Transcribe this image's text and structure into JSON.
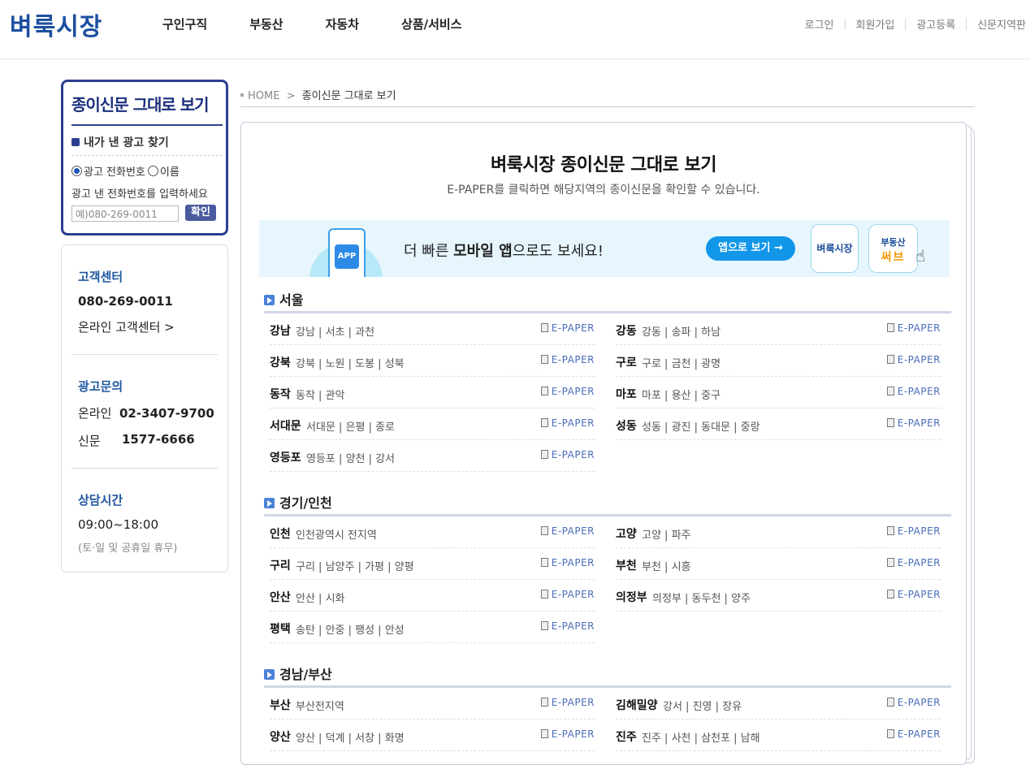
{
  "header": {
    "logo": "벼룩시장",
    "nav": [
      "구인구직",
      "부동산",
      "자동차",
      "상품/서비스"
    ],
    "util": [
      "로그인",
      "회원가입",
      "광고등록",
      "신문지역판"
    ]
  },
  "sidebar": {
    "paper_title": "종이신문 그대로 보기",
    "find_ad": "내가 낸 광고 찾기",
    "radio_phone": "광고 전화번호",
    "radio_name": "이름",
    "hint": "광고 낸 전화번호를 입력하세요",
    "phone_placeholder": "예)080-269-0011",
    "confirm": "확인",
    "cs_title": "고객센터",
    "cs_phone": "080-269-0011",
    "cs_online": "온라인 고객센터 >",
    "ad_title": "광고문의",
    "ad_online_label": "온라인",
    "ad_online_phone": "02-3407-9700",
    "ad_paper_label": "신문",
    "ad_paper_phone": "1577-6666",
    "hours_title": "상담시간",
    "hours": "09:00~18:00",
    "hours_note": "(토·일 및 공휴일 휴무)"
  },
  "breadcrumb": {
    "home": "HOME",
    "sep": ">",
    "current": "종이신문 그대로 보기"
  },
  "main": {
    "title": "벼룩시장 종이신문 그대로 보기",
    "desc": "E-PAPER를 클릭하면 해당지역의 종이신문을 확인할 수 있습니다.",
    "banner": {
      "app_label": "APP",
      "msg_pre": "더 빠른 ",
      "msg_bold": "모바일 앱",
      "msg_post": "으로도 보세요!",
      "button": "앱으로 보기 →",
      "icon1": "벼룩시장",
      "icon2_top": "부동산",
      "icon2_bottom": "써브"
    },
    "epaper_label": "E-PAPER",
    "sections": [
      {
        "name": "서울",
        "left": [
          {
            "city": "강남",
            "subs": "강남 | 서초 | 과천"
          },
          {
            "city": "강북",
            "subs": "강북 | 노원 | 도봉 | 성북"
          },
          {
            "city": "동작",
            "subs": "동작 | 관악"
          },
          {
            "city": "서대문",
            "subs": "서대문 | 은평 | 종로"
          },
          {
            "city": "영등포",
            "subs": "영등포 | 양천 | 강서"
          }
        ],
        "right": [
          {
            "city": "강동",
            "subs": "강동 | 송파 | 하남"
          },
          {
            "city": "구로",
            "subs": "구로 | 금천 | 광명"
          },
          {
            "city": "마포",
            "subs": "마포 | 용산 | 중구"
          },
          {
            "city": "성동",
            "subs": "성동 | 광진 | 동대문 | 중랑"
          }
        ]
      },
      {
        "name": "경기/인천",
        "left": [
          {
            "city": "인천",
            "subs": "인천광역시 전지역"
          },
          {
            "city": "구리",
            "subs": "구리 | 남양주 | 가평 | 양평"
          },
          {
            "city": "안산",
            "subs": "안산 | 시화"
          },
          {
            "city": "평택",
            "subs": "송탄 | 안중 | 팽성 | 안성"
          }
        ],
        "right": [
          {
            "city": "고양",
            "subs": "고양 | 파주"
          },
          {
            "city": "부천",
            "subs": "부천 | 시흥"
          },
          {
            "city": "의정부",
            "subs": "의정부 | 동두천 | 양주"
          }
        ]
      },
      {
        "name": "경남/부산",
        "left": [
          {
            "city": "부산",
            "subs": "부산전지역"
          },
          {
            "city": "양산",
            "subs": "양산 | 덕계 | 서창 | 화명"
          }
        ],
        "right": [
          {
            "city": "김해밀양",
            "subs": "강서 | 진영 | 장유"
          },
          {
            "city": "진주",
            "subs": "진주 | 사천 | 삼천포 | 남해"
          }
        ]
      }
    ]
  }
}
